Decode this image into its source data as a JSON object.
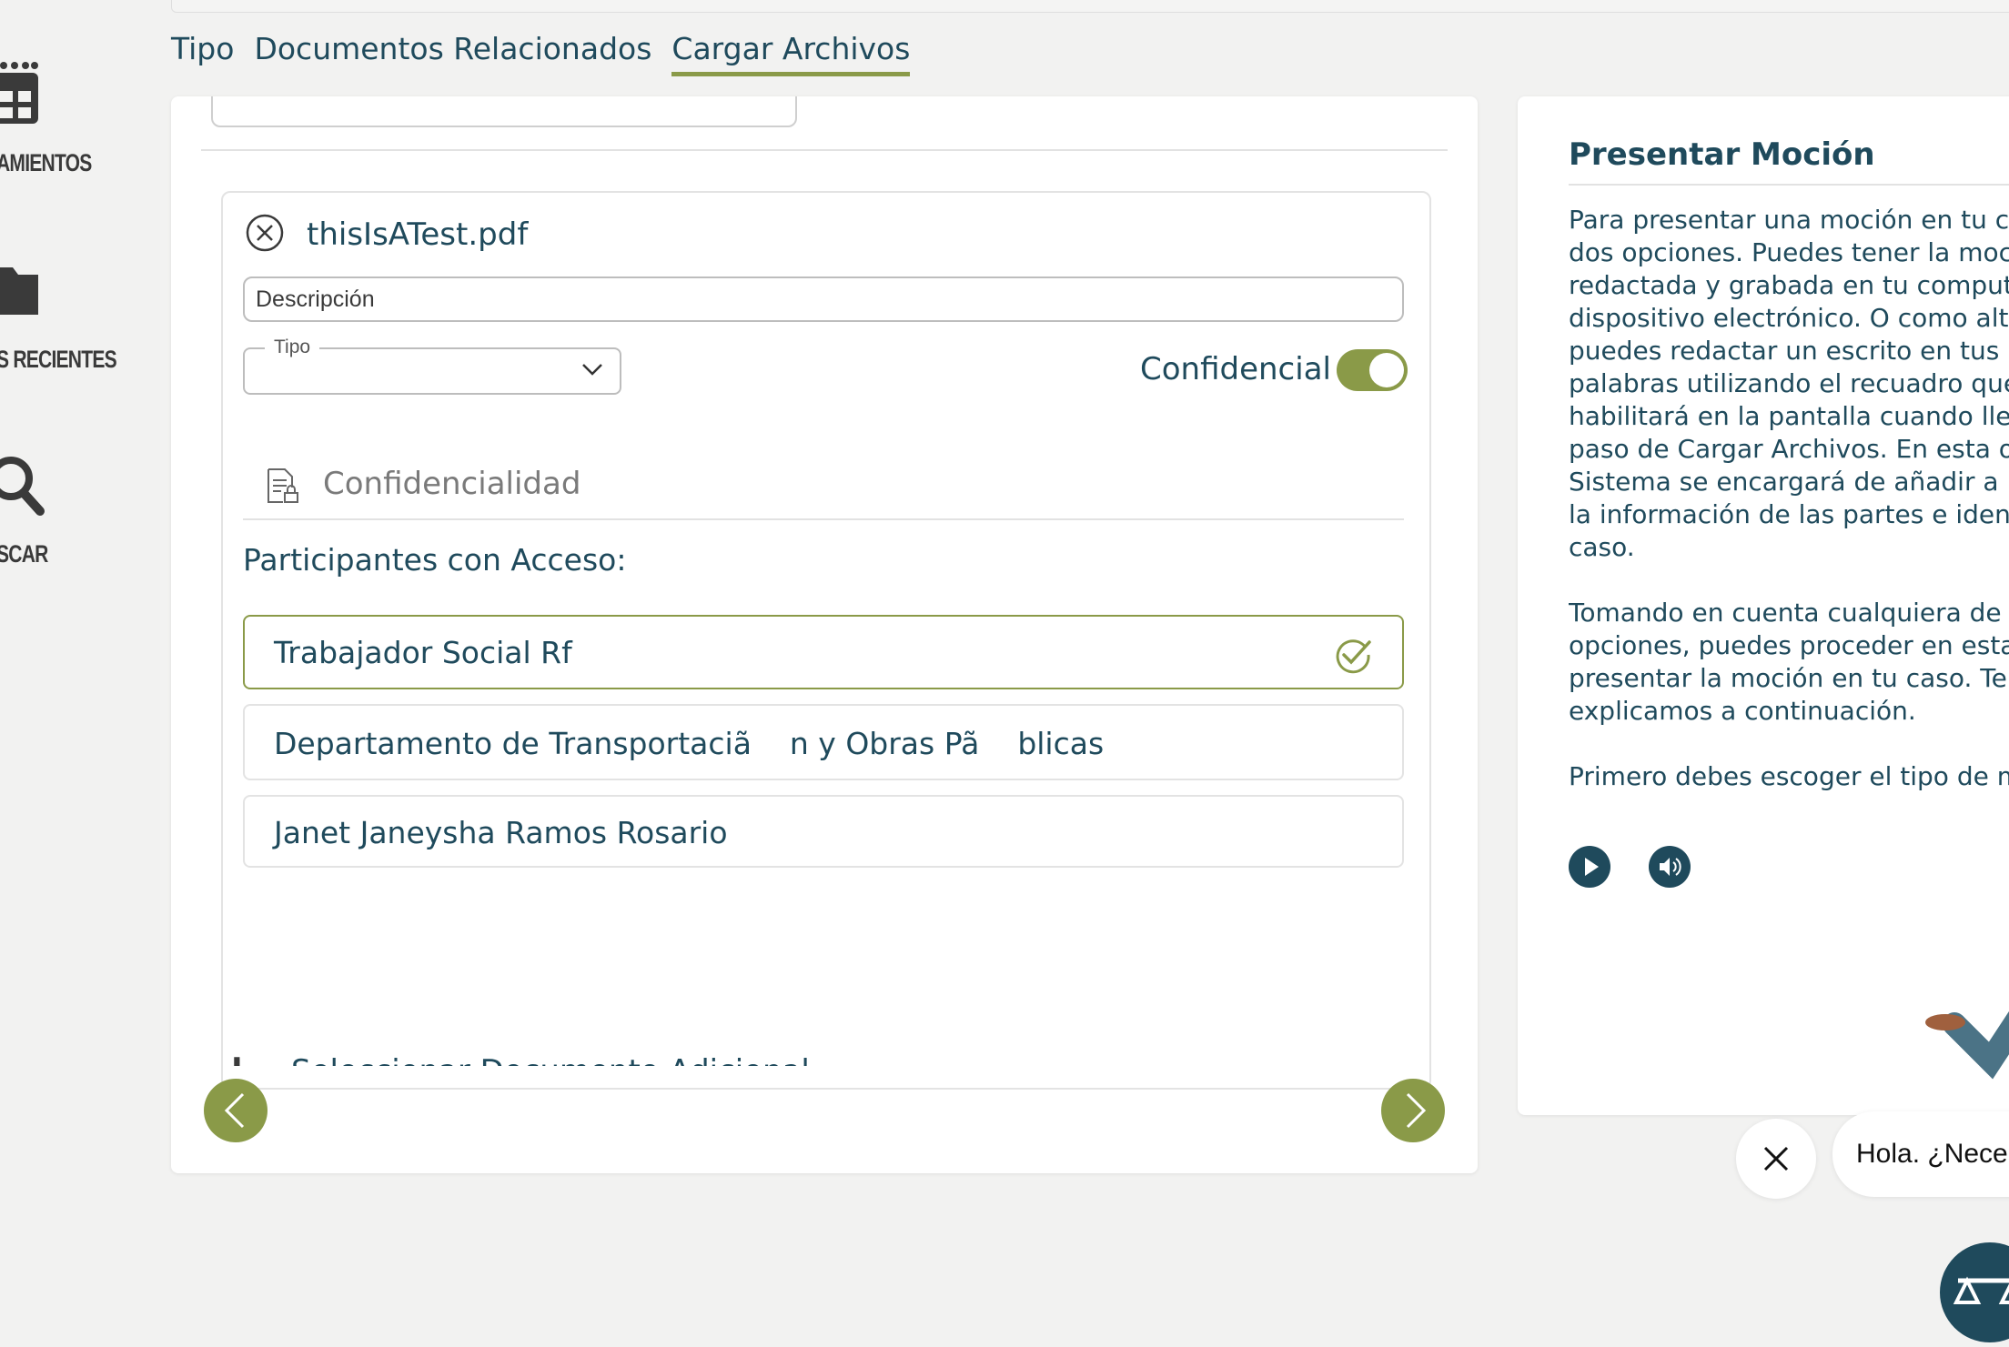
{
  "sidebar": {
    "items": [
      {
        "label": "AMIENTOS",
        "icon": "calendar-icon"
      },
      {
        "label": "S RECIENTES",
        "icon": "folder-icon"
      },
      {
        "label": "SCAR",
        "icon": "search-icon"
      }
    ]
  },
  "tabs": [
    {
      "label": "Tipo",
      "active": false
    },
    {
      "label": "Documentos Relacionados",
      "active": false
    },
    {
      "label": "Cargar Archivos",
      "active": true
    }
  ],
  "file": {
    "name": "thisIsATest.pdf",
    "description_placeholder": "Descripción",
    "tipo_label": "Tipo",
    "tipo_value": "",
    "confidential_label": "Confidencial",
    "confidential_on": true
  },
  "confidentiality": {
    "title": "Confidencialidad",
    "participants_title": "Participantes con Acceso:",
    "participants": [
      {
        "name": "Trabajador Social Rf",
        "selected": true
      },
      {
        "name": "Departamento de Transportaciã    n y Obras Pã    blicas",
        "selected": false
      },
      {
        "name": "Janet Janeysha Ramos Rosario",
        "selected": false
      }
    ]
  },
  "add_document": {
    "label": "Seleccionar Documento Adicional",
    "icon": "plus-icon"
  },
  "help": {
    "title": "Presentar Moción",
    "paragraphs": [
      "Para presentar una moción en tu ca\ndos opciones. Puedes tener la moci\nredactada y grabada en tu computa\ndispositivo electrónico. O como alte\npuedes redactar un escrito en tus p\npalabras utilizando el recuadro que\nhabilitará en la pantalla cuando lleg\npaso de Cargar Archivos. En esta op\nSistema se encargará de añadir a la\nla información de las partes e identi\ncaso.",
      "Tomando en cuenta cualquiera de la\nopciones, puedes proceder en esta\npresentar la moción en tu caso. Te\nexplicamos a continuación.",
      "Primero debes escoger el tipo de m"
    ]
  },
  "chat": {
    "greeting": "Hola. ¿Nece"
  },
  "colors": {
    "accent": "#8a9a48",
    "primary": "#1f4a5c",
    "background": "#f2f2f1"
  }
}
